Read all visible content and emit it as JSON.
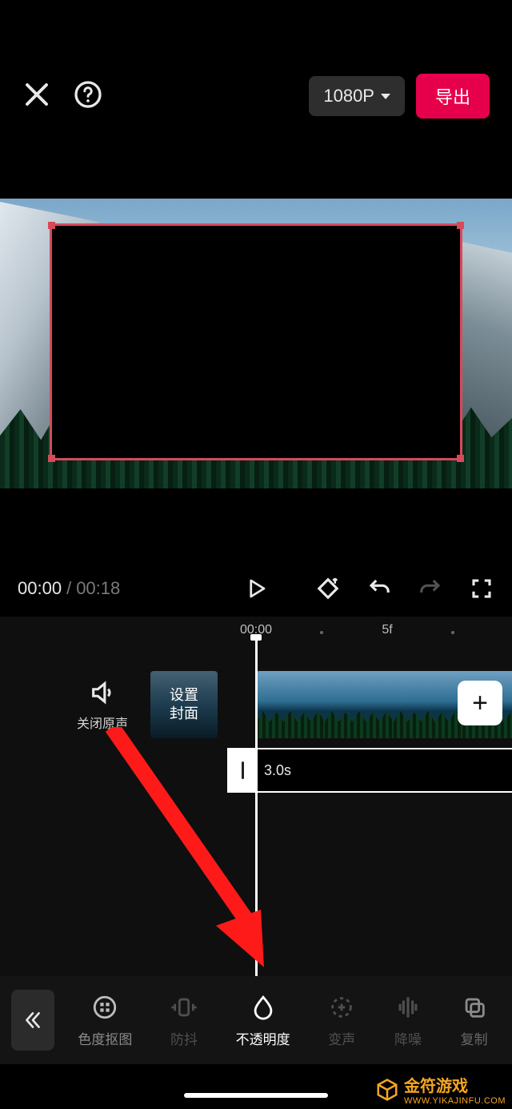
{
  "topbar": {
    "resolution_label": "1080P",
    "export_label": "导出"
  },
  "playback": {
    "current_time": "00:00",
    "separator": "/",
    "duration": "00:18"
  },
  "ruler": {
    "tick_zero": "00:00",
    "tick_5f": "5f"
  },
  "timeline": {
    "mute_original_label": "关闭原声",
    "cover_label_line1": "设置",
    "cover_label_line2": "封面",
    "secondary_clip_duration": "3.0s",
    "add_button": "+"
  },
  "tools": [
    {
      "id": "chroma-key",
      "label": "色度抠图",
      "active": false
    },
    {
      "id": "stabilize",
      "label": "防抖",
      "active": false,
      "dim": true
    },
    {
      "id": "opacity",
      "label": "不透明度",
      "active": true
    },
    {
      "id": "voice-fx",
      "label": "变声",
      "active": false,
      "dim": true
    },
    {
      "id": "denoise",
      "label": "降噪",
      "active": false,
      "dim": true
    },
    {
      "id": "copy",
      "label": "复制",
      "active": false,
      "dim": true
    }
  ],
  "watermark": {
    "name": "金符游戏",
    "url": "WWW.YIKAJINFU.COM"
  }
}
